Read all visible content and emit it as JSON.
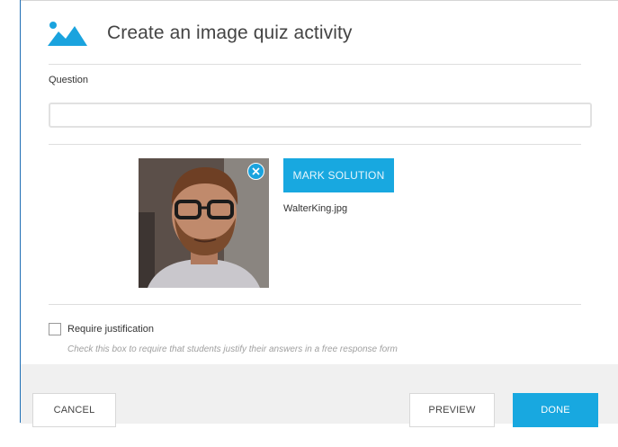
{
  "header": {
    "title": "Create an image quiz activity",
    "icon": "mountains-image-icon",
    "accent": "#1aa3de"
  },
  "question": {
    "label": "Question",
    "value": "",
    "placeholder": ""
  },
  "image": {
    "filename": "WalterKing.jpg",
    "mark_label": "MARK SOLUTION",
    "remove_icon": "close-icon"
  },
  "justification": {
    "checked": false,
    "label": "Require justification",
    "help": "Check this box to require that students justify their answers in a free response form"
  },
  "footer": {
    "cancel_label": "CANCEL",
    "preview_label": "PREVIEW",
    "done_label": "DONE"
  },
  "colors": {
    "primary": "#18a8e0",
    "footer_bg": "#f0f0f0"
  }
}
